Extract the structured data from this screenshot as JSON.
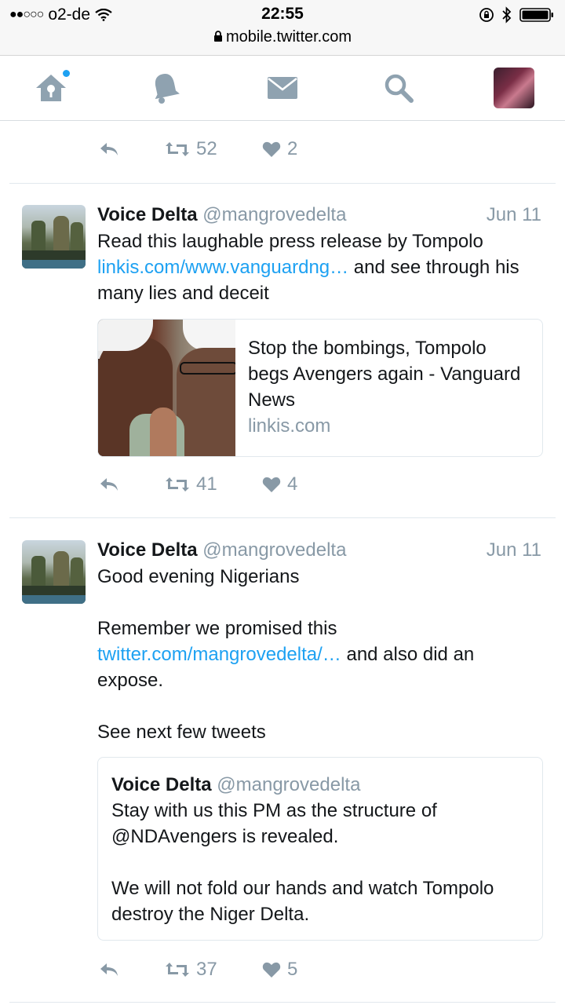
{
  "status_bar": {
    "signal_dots": "●●○○○",
    "carrier": "o2-de",
    "time": "22:55",
    "url": "mobile.twitter.com"
  },
  "nav": {
    "items": [
      {
        "name": "home",
        "icon": "home-icon",
        "has_notification_dot": true
      },
      {
        "name": "notifications",
        "icon": "bell-icon"
      },
      {
        "name": "messages",
        "icon": "envelope-icon"
      },
      {
        "name": "search",
        "icon": "search-icon"
      },
      {
        "name": "profile",
        "icon": "avatar"
      }
    ]
  },
  "colors": {
    "link": "#1da1f2",
    "muted": "#8899a6",
    "icon": "#8fa2b0"
  },
  "tweets": [
    {
      "partial": true,
      "retweets": "52",
      "likes": "2"
    },
    {
      "name": "Voice Delta",
      "handle": "@mangrovedelta",
      "date": "Jun 11",
      "text_1": "Read this laughable press release by Tompolo",
      "link": "linkis.com/www.vanguardng…",
      "text_2": " and see through his many lies and deceit",
      "card": {
        "title": "Stop the bombings, Tompolo begs Avengers again - Vanguard News",
        "domain": "linkis.com"
      },
      "retweets": "41",
      "likes": "4"
    },
    {
      "name": "Voice Delta",
      "handle": "@mangrovedelta",
      "date": "Jun 11",
      "line_1": "Good evening Nigerians",
      "text_a": "Remember we promised this",
      "link": "twitter.com/mangrovedelta/…",
      "text_b": " and also did an expose.",
      "line_3": "See next few tweets",
      "quote": {
        "name": "Voice Delta",
        "handle": "@mangrovedelta",
        "para_1": "Stay with us this PM as the structure of @NDAvengers  is revealed.",
        "para_2": "We will not fold our hands and watch Tompolo destroy the Niger Delta."
      },
      "retweets": "37",
      "likes": "5"
    }
  ]
}
